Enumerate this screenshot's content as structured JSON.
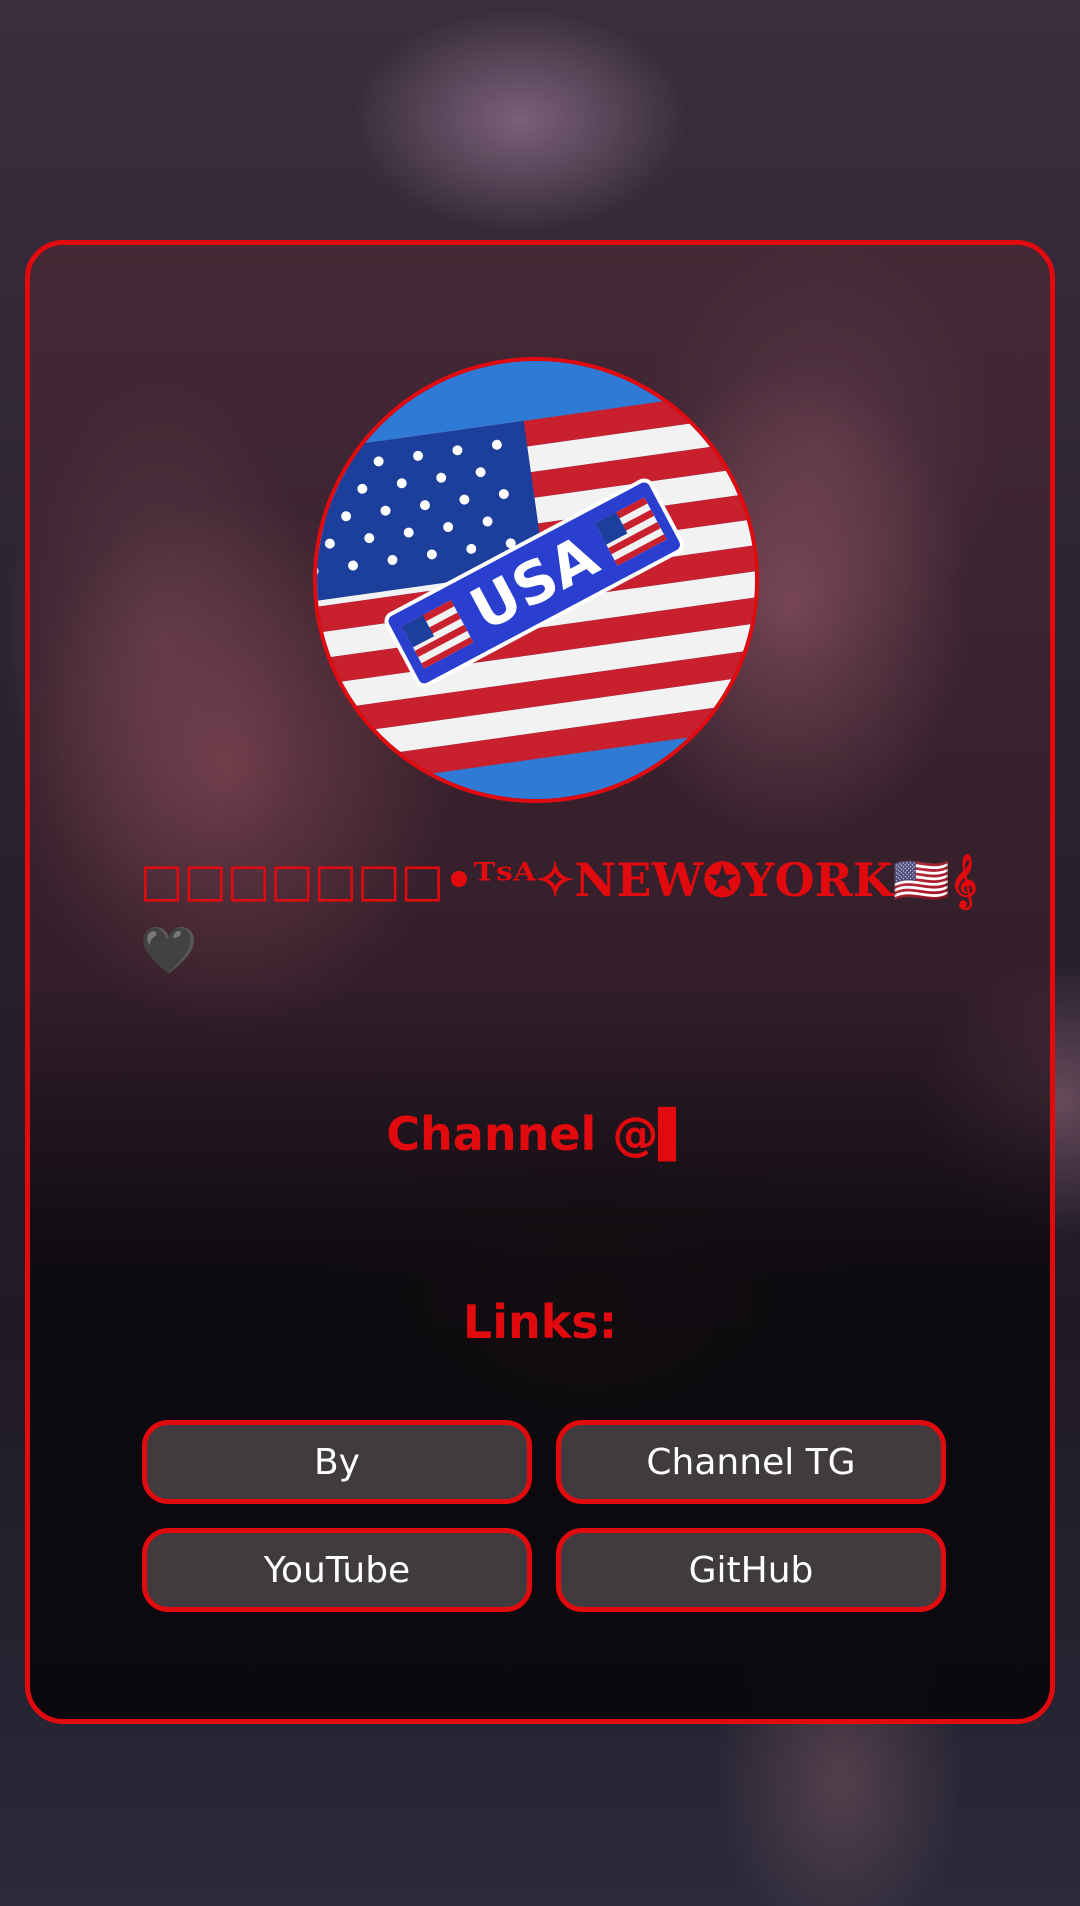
{
  "profile": {
    "avatar_icon": "usa-flag-image",
    "avatar_text": "USA",
    "name": "□□□□□□□•ᵁˢᴬ✧NEW✪YORK🇺🇸𝄞 🖤",
    "channel": "Channel @▌"
  },
  "links": {
    "heading": "Links:",
    "buttons": [
      {
        "label": "By"
      },
      {
        "label": "Channel TG"
      },
      {
        "label": "YouTube"
      },
      {
        "label": "GitHub"
      }
    ]
  },
  "colors": {
    "accent": "#e10a0e",
    "button_bg": "#3f3b3f",
    "button_text": "#ffffff"
  }
}
